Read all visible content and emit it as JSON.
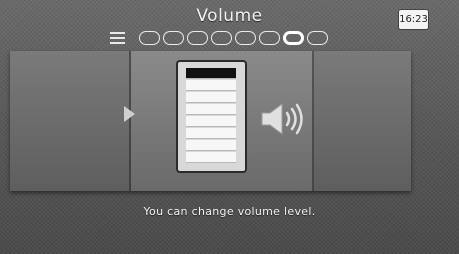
{
  "header": {
    "title": "Volume",
    "clock": "16:23"
  },
  "pager": {
    "page_count": 8,
    "active_index": 6
  },
  "volume": {
    "segments": 8,
    "level": 1
  },
  "footer": {
    "hint": "You can change volume level."
  },
  "colors": {
    "text": "#f2f2f2",
    "meter_fill": "#111111",
    "meter_empty": "#f7f7f7"
  },
  "icons": {
    "menu": "menu-icon",
    "prev": "arrow-left-icon",
    "speaker": "speaker-icon"
  }
}
